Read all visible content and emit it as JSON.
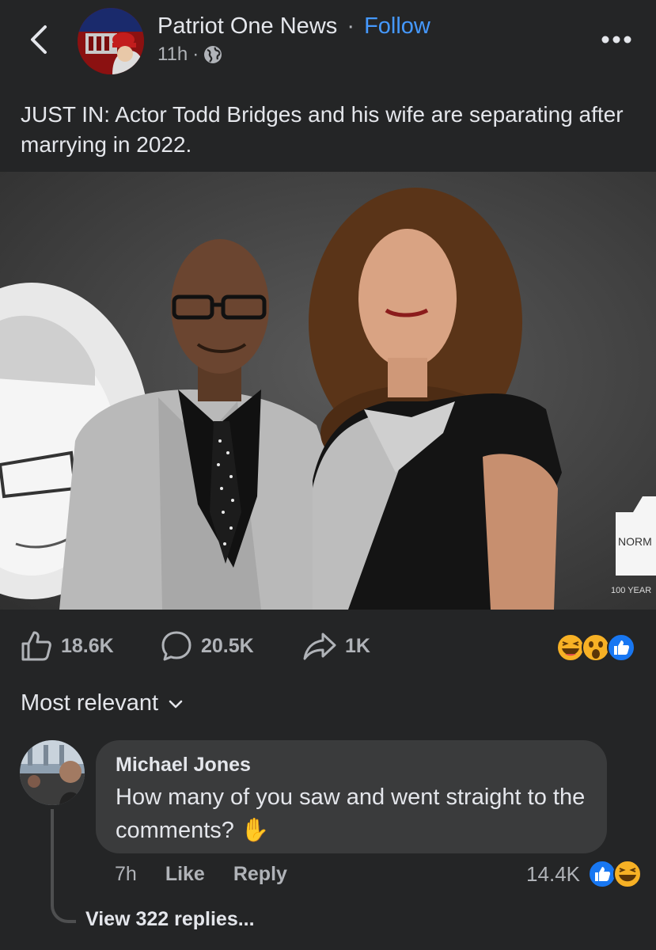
{
  "header": {
    "page_name": "Patriot One News",
    "separator": "·",
    "follow_label": "Follow",
    "time": "11h",
    "meta_separator": "·",
    "privacy_icon": "globe-icon",
    "back_icon": "chevron-left-icon",
    "more_icon": "more-dots-icon"
  },
  "post": {
    "text": "JUST IN: Actor Todd Bridges and his wife are separating after marrying in 2022.",
    "photo_sign_text": "NORM",
    "photo_sign_subtext": "100 YEAR"
  },
  "actions": {
    "like_count": "18.6K",
    "comment_count": "20.5K",
    "share_count": "1K",
    "reaction_icons": [
      "haha-reaction-icon",
      "wow-reaction-icon",
      "like-reaction-icon"
    ]
  },
  "sort": {
    "label": "Most relevant"
  },
  "comment": {
    "author": "Michael Jones",
    "text": "How many of you saw and went straight to the comments? ✋",
    "time": "7h",
    "like_label": "Like",
    "reply_label": "Reply",
    "reaction_count": "14.4K",
    "view_replies_label": "View 322 replies..."
  },
  "colors": {
    "background": "#242526",
    "bubble": "#3a3b3c",
    "accent": "#4599ff",
    "secondary_text": "#b0b3b8"
  }
}
